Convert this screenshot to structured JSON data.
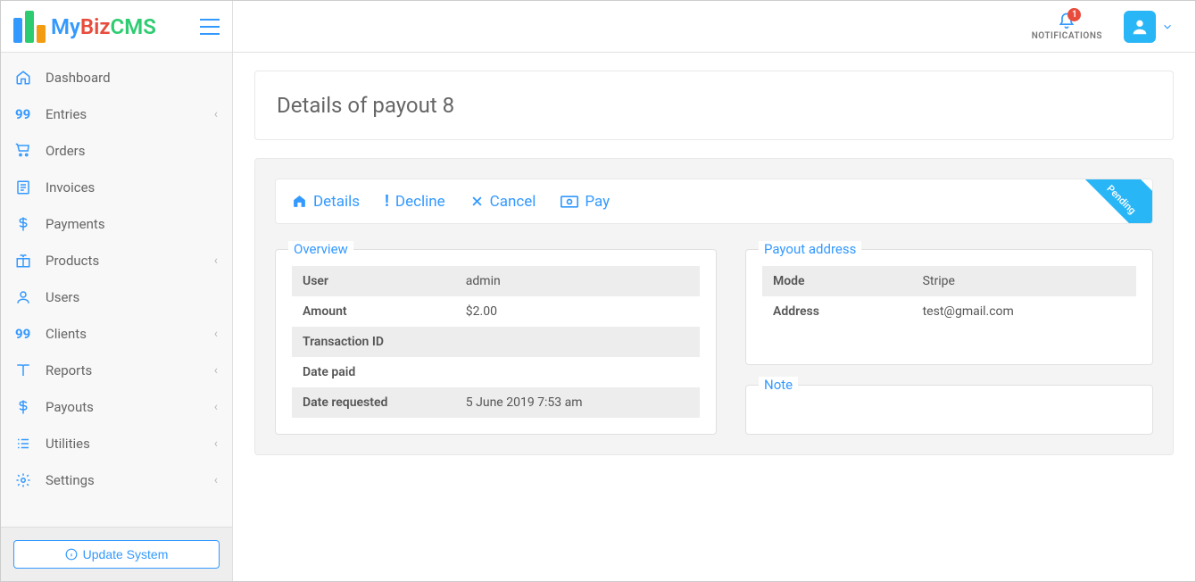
{
  "brand": {
    "part1": "My",
    "part2": "Biz",
    "part3": "CMS"
  },
  "sidebar": {
    "items": [
      {
        "label": "Dashboard",
        "icon": "home-icon",
        "expandable": false
      },
      {
        "label": "Entries",
        "icon": "num99-icon",
        "expandable": true
      },
      {
        "label": "Orders",
        "icon": "cart-icon",
        "expandable": false
      },
      {
        "label": "Invoices",
        "icon": "invoice-icon",
        "expandable": false
      },
      {
        "label": "Payments",
        "icon": "dollar-icon",
        "expandable": false
      },
      {
        "label": "Products",
        "icon": "gift-icon",
        "expandable": true
      },
      {
        "label": "Users",
        "icon": "user-icon",
        "expandable": false
      },
      {
        "label": "Clients",
        "icon": "num99-icon",
        "expandable": true
      },
      {
        "label": "Reports",
        "icon": "book-icon",
        "expandable": true
      },
      {
        "label": "Payouts",
        "icon": "dollar-icon",
        "expandable": true
      },
      {
        "label": "Utilities",
        "icon": "list-icon",
        "expandable": true
      },
      {
        "label": "Settings",
        "icon": "gear-icon",
        "expandable": true
      }
    ],
    "update_btn": "Update System"
  },
  "topbar": {
    "notifications_label": "NOTIFICATIONS",
    "notifications_count": "1"
  },
  "page": {
    "title": "Details of payout 8"
  },
  "tabs": {
    "details": "Details",
    "decline": "Decline",
    "cancel": "Cancel",
    "pay": "Pay"
  },
  "status_ribbon": "Pending",
  "overview": {
    "legend": "Overview",
    "rows": [
      {
        "label": "User",
        "value": "admin"
      },
      {
        "label": "Amount",
        "value": "$2.00"
      },
      {
        "label": "Transaction ID",
        "value": ""
      },
      {
        "label": "Date paid",
        "value": ""
      },
      {
        "label": "Date requested",
        "value": "5 June 2019 7:53 am"
      }
    ]
  },
  "payout_address": {
    "legend": "Payout address",
    "rows": [
      {
        "label": "Mode",
        "value": "Stripe"
      },
      {
        "label": "Address",
        "value": "test@gmail.com"
      }
    ]
  },
  "note": {
    "legend": "Note"
  }
}
